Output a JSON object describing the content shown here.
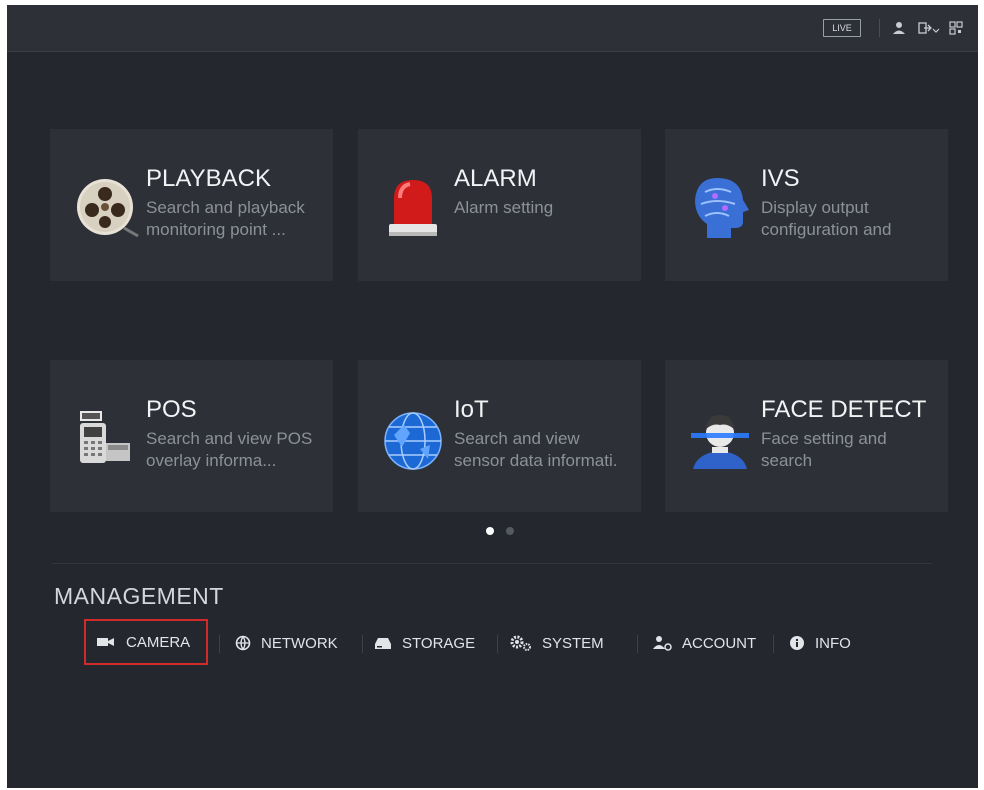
{
  "topbar": {
    "live_label": "LIVE"
  },
  "tiles": [
    {
      "title": "PLAYBACK",
      "desc": "Search and playback monitoring point ...",
      "icon": "film-reel-icon"
    },
    {
      "title": "ALARM",
      "desc": "Alarm setting",
      "icon": "alarm-light-icon"
    },
    {
      "title": "IVS",
      "desc": "Display output configuration and",
      "icon": "brain-head-icon"
    },
    {
      "title": "POS",
      "desc": "Search and view POS overlay informa...",
      "icon": "pos-terminal-icon"
    },
    {
      "title": "IoT",
      "desc": "Search and view sensor data informati.",
      "icon": "globe-icon"
    },
    {
      "title": "FACE DETECT",
      "desc": "Face setting and search",
      "icon": "face-scan-icon"
    }
  ],
  "pagination": {
    "current": 1,
    "total": 2
  },
  "management": {
    "title": "MANAGEMENT",
    "items": [
      {
        "label": "CAMERA",
        "icon": "camera-icon"
      },
      {
        "label": "NETWORK",
        "icon": "network-icon"
      },
      {
        "label": "STORAGE",
        "icon": "storage-icon"
      },
      {
        "label": "SYSTEM",
        "icon": "gears-icon"
      },
      {
        "label": "ACCOUNT",
        "icon": "account-icon"
      },
      {
        "label": "INFO",
        "icon": "info-icon"
      }
    ]
  },
  "colors": {
    "background": "#24272e",
    "tile": "#2d3037",
    "active_border": "#d02a2a"
  }
}
